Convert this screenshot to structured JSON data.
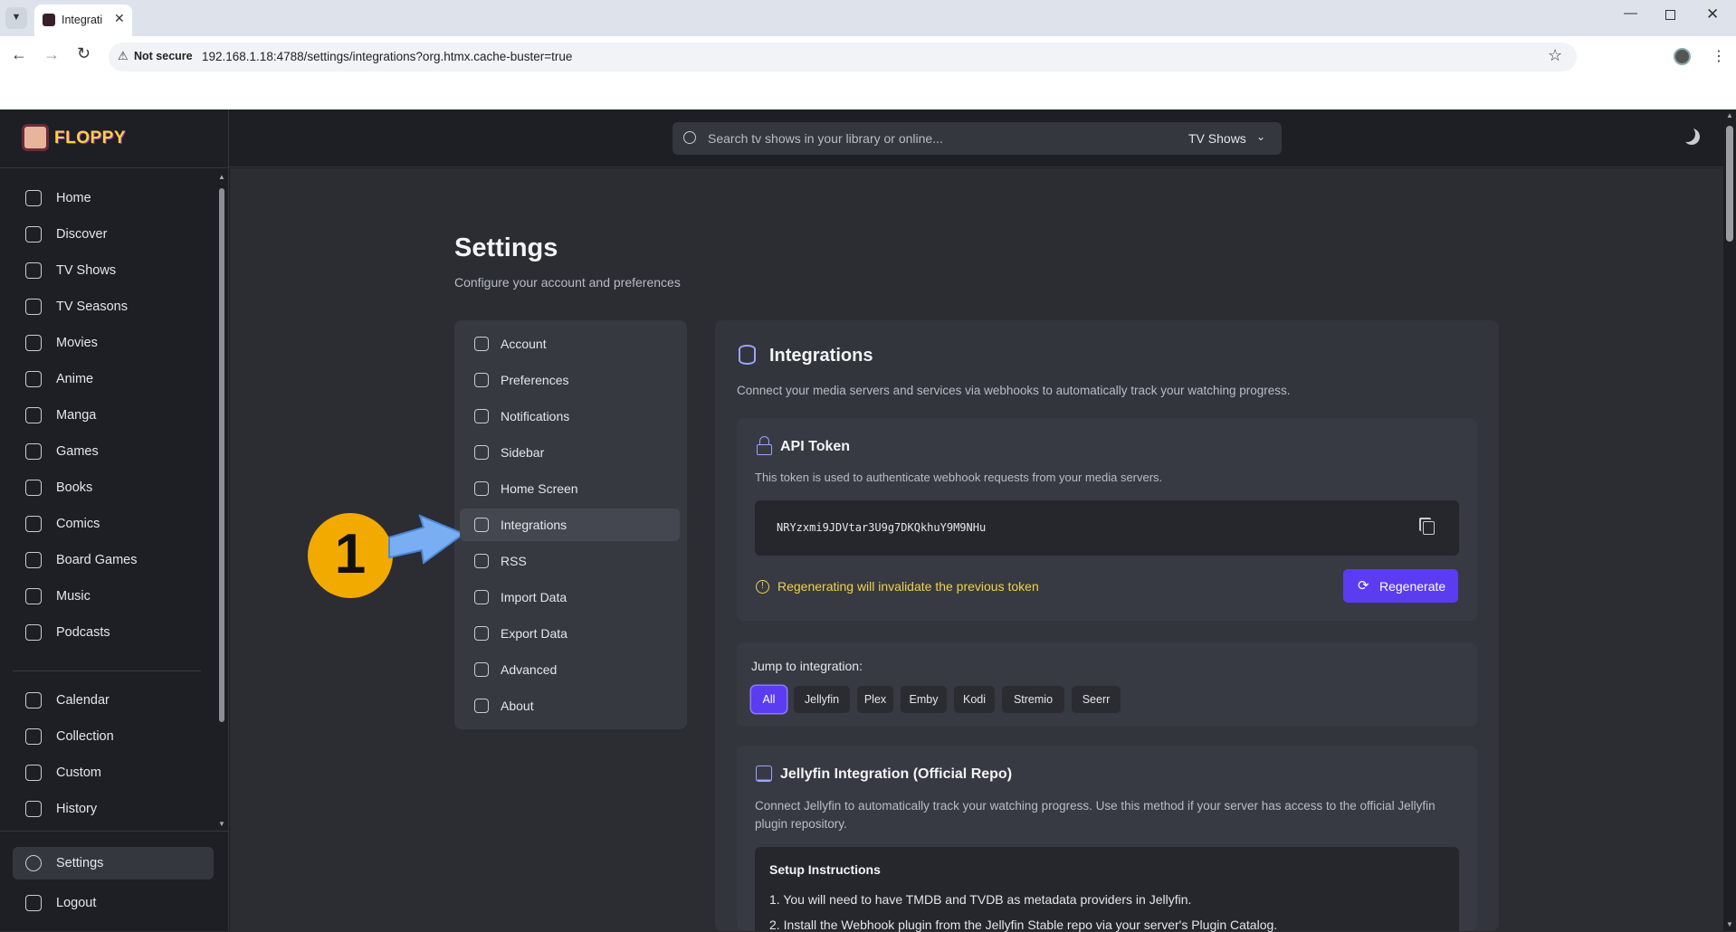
{
  "browser": {
    "tab_title": "Integrati",
    "security_label": "Not secure",
    "url": "192.168.1.18:4788/settings/integrations?org.htmx.cache-buster=true"
  },
  "app": {
    "logo_text": "FLOPPY",
    "search_placeholder": "Search tv shows in your library or online...",
    "search_scope": "TV Shows"
  },
  "sidebar": {
    "items": [
      {
        "label": "Home",
        "icon": "home-icon"
      },
      {
        "label": "Discover",
        "icon": "grid-icon"
      },
      {
        "label": "TV Shows",
        "icon": "tv-icon"
      },
      {
        "label": "TV Seasons",
        "icon": "layers-icon"
      },
      {
        "label": "Movies",
        "icon": "film-icon"
      },
      {
        "label": "Anime",
        "icon": "play-circle-icon"
      },
      {
        "label": "Manga",
        "icon": "document-icon"
      },
      {
        "label": "Games",
        "icon": "gamepad-icon"
      },
      {
        "label": "Books",
        "icon": "book-icon"
      },
      {
        "label": "Comics",
        "icon": "library-icon"
      },
      {
        "label": "Board Games",
        "icon": "dice-icon"
      },
      {
        "label": "Music",
        "icon": "music-icon"
      },
      {
        "label": "Podcasts",
        "icon": "microphone-icon"
      }
    ],
    "items2": [
      {
        "label": "Calendar",
        "icon": "calendar-icon"
      },
      {
        "label": "Collection",
        "icon": "box-icon"
      },
      {
        "label": "Custom",
        "icon": "plus-circle-icon"
      },
      {
        "label": "History",
        "icon": "history-icon"
      }
    ],
    "settings_label": "Settings",
    "logout_label": "Logout"
  },
  "page": {
    "title": "Settings",
    "subtitle": "Configure your account and preferences"
  },
  "settings_nav": [
    {
      "label": "Account",
      "icon": "user-icon"
    },
    {
      "label": "Preferences",
      "icon": "sliders-icon"
    },
    {
      "label": "Notifications",
      "icon": "bell-icon"
    },
    {
      "label": "Sidebar",
      "icon": "sidebar-icon"
    },
    {
      "label": "Home Screen",
      "icon": "home-icon"
    },
    {
      "label": "Integrations",
      "icon": "database-icon"
    },
    {
      "label": "RSS",
      "icon": "rss-icon"
    },
    {
      "label": "Import Data",
      "icon": "file-upload-icon"
    },
    {
      "label": "Export Data",
      "icon": "file-download-icon"
    },
    {
      "label": "Advanced",
      "icon": "shield-icon"
    },
    {
      "label": "About",
      "icon": "info-icon"
    }
  ],
  "integrations": {
    "title": "Integrations",
    "description": "Connect your media servers and services via webhooks to automatically track your watching progress.",
    "api": {
      "title": "API Token",
      "description": "This token is used to authenticate webhook requests from your media servers.",
      "token": "NRYzxmi9JDVtar3U9g7DKQkhuY9M9NHu",
      "warning": "Regenerating will invalidate the previous token",
      "regenerate_label": "Regenerate"
    },
    "jump": {
      "label": "Jump to integration:",
      "chips": [
        "All",
        "Jellyfin",
        "Plex",
        "Emby",
        "Kodi",
        "Stremio",
        "Seerr"
      ]
    },
    "jellyfin": {
      "title": "Jellyfin Integration (Official Repo)",
      "description": "Connect Jellyfin to automatically track your watching progress. Use this method if your server has access to the official Jellyfin plugin repository.",
      "setup_title": "Setup Instructions",
      "step1": "1. You will need to have TMDB and TVDB as metadata providers in Jellyfin.",
      "step2": "2. Install the Webhook plugin from the Jellyfin Stable repo via your server's Plugin Catalog."
    }
  },
  "annotation": {
    "number": "1"
  },
  "colors": {
    "accent": "#5b3cf0",
    "warning": "#f0d24a",
    "badge": "#f2a900",
    "arrow": "#79aff2"
  }
}
